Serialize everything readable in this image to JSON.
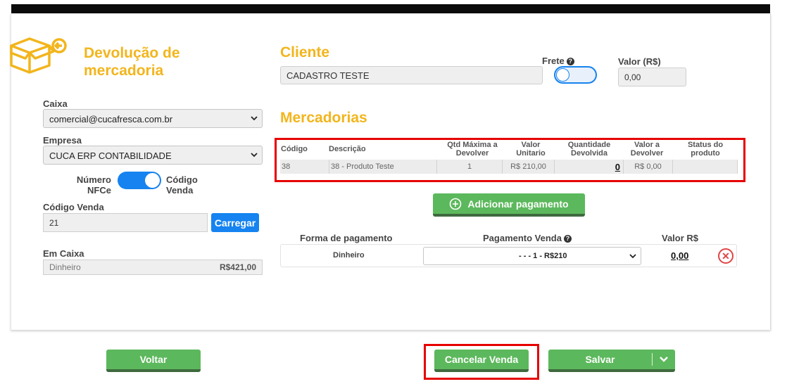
{
  "header": {
    "title": "Devolução de mercadoria"
  },
  "left": {
    "caixa_label": "Caixa",
    "caixa_value": "comercial@cucafresca.com.br",
    "empresa_label": "Empresa",
    "empresa_value": "CUCA ERP CONTABILIDADE",
    "toggle_left_label": "Número NFCe",
    "toggle_right_label": "Código Venda",
    "codigo_venda_label": "Código Venda",
    "codigo_venda_value": "21",
    "carregar_label": "Carregar",
    "em_caixa_label": "Em Caixa",
    "em_caixa_method": "Dinheiro",
    "em_caixa_amount": "R$421,00"
  },
  "cliente": {
    "title": "Cliente",
    "value": "CADASTRO TESTE",
    "frete_label": "Frete",
    "valor_label": "Valor (R$)",
    "valor_value": "0,00"
  },
  "mercadorias": {
    "title": "Mercadorias",
    "columns": [
      "Código",
      "Descrição",
      "Qtd Máxima a Devolver",
      "Valor Unitario",
      "Quantidade Devolvida",
      "Valor a Devolver",
      "Status do produto"
    ],
    "rows": [
      {
        "codigo": "38",
        "descricao": "38 - Produto Teste",
        "qtd_max": "1",
        "valor_unit": "R$ 210,00",
        "qtd_devolvida": "0",
        "valor_devolver": "R$ 0,00",
        "status": ""
      }
    ]
  },
  "pagamento": {
    "add_button": "Adicionar pagamento",
    "col_forma": "Forma de pagamento",
    "col_pagamento_venda": "Pagamento Venda",
    "col_valor": "Valor R$",
    "row_forma": "Dinheiro",
    "row_select": "- - - 1 - R$210",
    "row_valor": "0,00"
  },
  "footer": {
    "voltar": "Voltar",
    "cancelar": "Cancelar Venda",
    "salvar": "Salvar"
  },
  "colors": {
    "accent_yellow": "#f2b51c",
    "primary_blue": "#1683f0",
    "success_green": "#5cb85c",
    "highlight_red": "#e60000"
  }
}
